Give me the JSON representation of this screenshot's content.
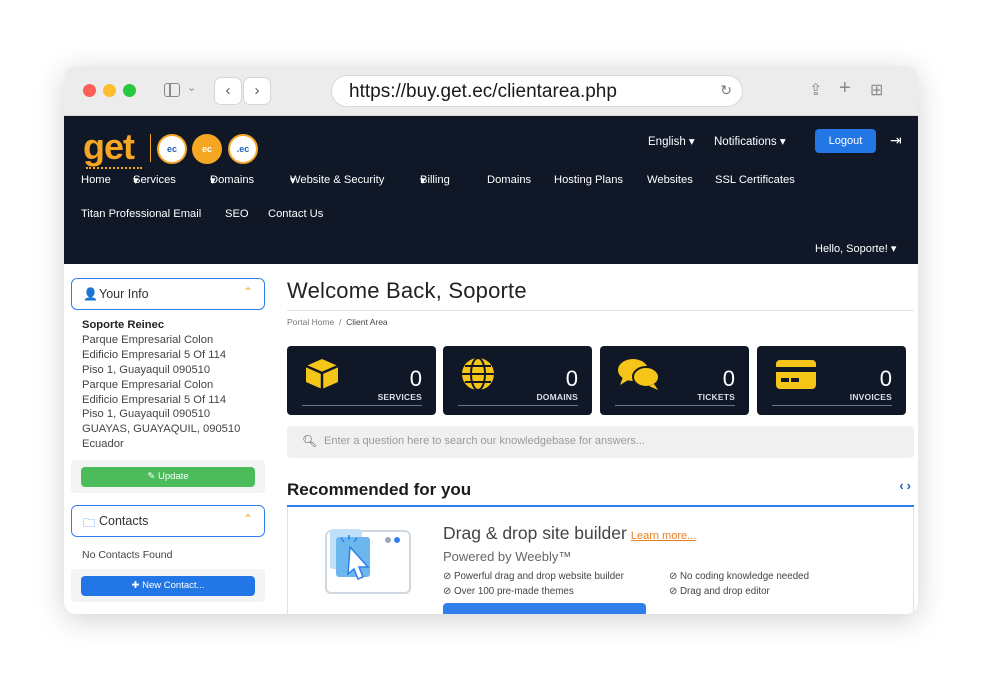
{
  "browser": {
    "url": "https://buy.get.ec/clientarea.php"
  },
  "header": {
    "logo_text": "get",
    "badges": [
      "ec",
      "ec",
      ".ec"
    ],
    "language": "English",
    "notifications": "Notifications",
    "logout": "Logout",
    "nav_row1": [
      "Home",
      "Services",
      "Domains",
      "Website & Security",
      "Billing",
      "Domains",
      "Hosting Plans",
      "Websites",
      "SSL Certificates"
    ],
    "nav_row2": [
      "Titan Professional Email",
      "SEO",
      "Contact Us"
    ],
    "hello": "Hello, Soporte!"
  },
  "your_info": {
    "title": "Your Info",
    "name": "Soporte Reinec",
    "address_lines": [
      "Parque Empresarial Colon",
      "Edificio Empresarial 5 Of 114",
      "Piso 1, Guayaquil 090510",
      "Parque Empresarial Colon",
      "Edificio Empresarial 5 Of 114",
      "Piso 1, Guayaquil 090510",
      "GUAYAS, GUAYAQUIL, 090510",
      "Ecuador"
    ],
    "update_button": "✎ Update"
  },
  "contacts": {
    "title": "Contacts",
    "empty_text": "No Contacts Found",
    "new_button": "✚ New Contact..."
  },
  "main": {
    "welcome": "Welcome Back, Soporte",
    "breadcrumb": [
      "Portal Home",
      "Client Area"
    ],
    "tiles": [
      {
        "label": "SERVICES",
        "count": "0",
        "icon": "cube-icon"
      },
      {
        "label": "DOMAINS",
        "count": "0",
        "icon": "globe-icon"
      },
      {
        "label": "TICKETS",
        "count": "0",
        "icon": "comments-icon"
      },
      {
        "label": "INVOICES",
        "count": "0",
        "icon": "credit-card-icon"
      }
    ],
    "search_placeholder": "Enter a question here to search our knowledgebase for answers...",
    "recommended_title": "Recommended for you",
    "reco": {
      "heading": "Drag & drop site builder",
      "learn_more": "Learn more...",
      "powered": "Powered by Weebly™",
      "features": [
        "Powerful drag and drop website builder",
        "No coding knowledge needed",
        "Over 100 pre-made themes",
        "Drag and drop editor"
      ]
    }
  },
  "colors": {
    "header_bg": "#101828",
    "accent_blue": "#2376e5",
    "brand_orange": "#f5a623",
    "update_green": "#4cbb5b",
    "tile_icon_yellow": "#f5c518"
  }
}
